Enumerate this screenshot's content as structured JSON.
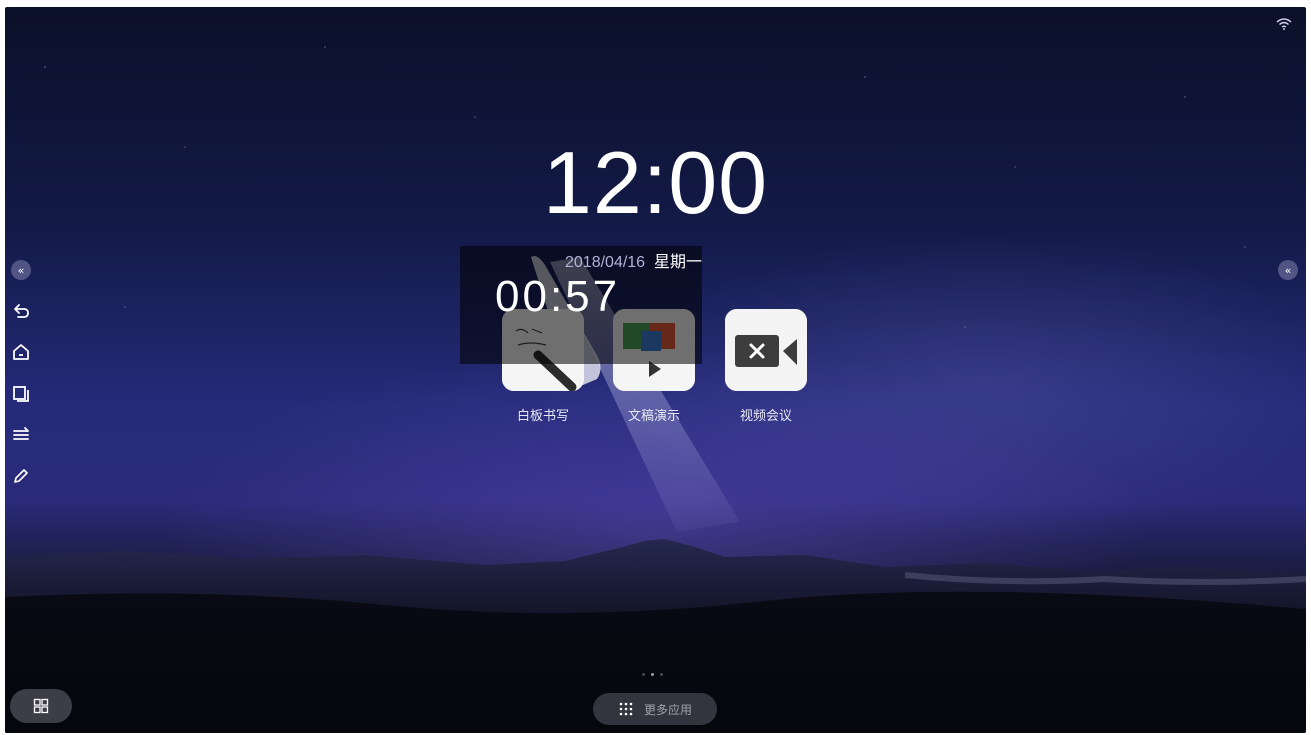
{
  "status_bar": {
    "wifi_icon": "wifi-icon"
  },
  "clock": {
    "time": "12:00",
    "date": "2018/04/16",
    "weekday": "星期一"
  },
  "timer_overlay": {
    "time": "00:57"
  },
  "apps": [
    {
      "label": "白板书写",
      "icon": "whiteboard-icon"
    },
    {
      "label": "文稿演示",
      "icon": "presentation-icon"
    },
    {
      "label": "视频会议",
      "icon": "video-meeting-icon"
    }
  ],
  "side_toolbar": {
    "collapse_left": "«",
    "collapse_right": "«",
    "tools": [
      "back-icon",
      "home-icon",
      "windows-icon",
      "menu-icon",
      "pen-icon"
    ]
  },
  "dock": {
    "more_apps_label": "更多应用",
    "grid_icon": "grid-icon",
    "windows_icon": "windows-switch-icon"
  },
  "pager": {
    "pages": 3,
    "active": 2
  },
  "colors": {
    "sky_top": "#0b1029",
    "sky_mid": "#2b2a7a",
    "ground": "#030304"
  }
}
